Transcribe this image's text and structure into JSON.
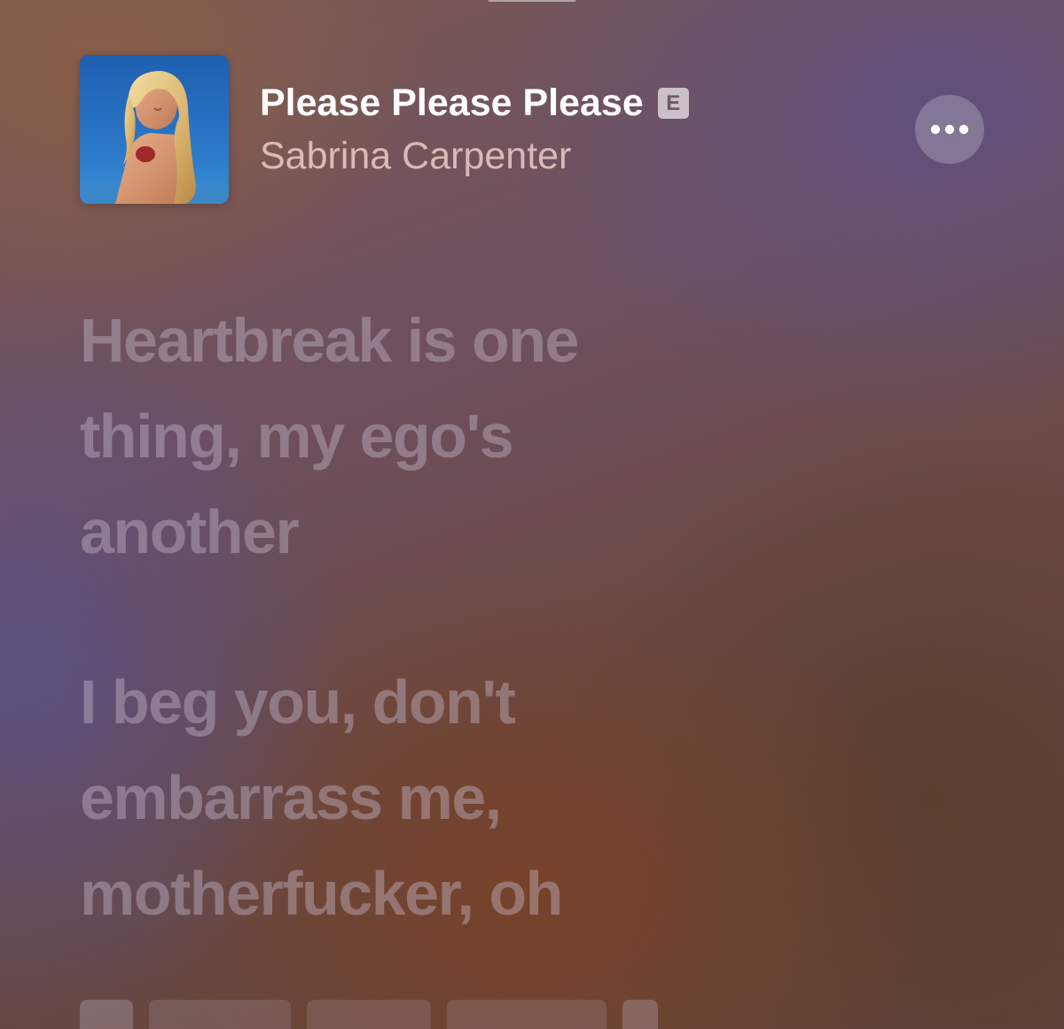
{
  "now_playing": {
    "title": "Please Please Please",
    "explicit_badge": "E",
    "artist": "Sabrina Carpenter",
    "more_icon": "ellipsis-icon"
  },
  "lyrics": {
    "stanzas": [
      "Heartbreak is one\nthing, my ego's\nanother",
      "I beg you, don't\nembarrass me,\nmotherfucker, oh"
    ]
  },
  "colors": {
    "title": "#ffffff",
    "artist": "#ebcdc8",
    "lyric_inactive": "#c8b9cd"
  }
}
